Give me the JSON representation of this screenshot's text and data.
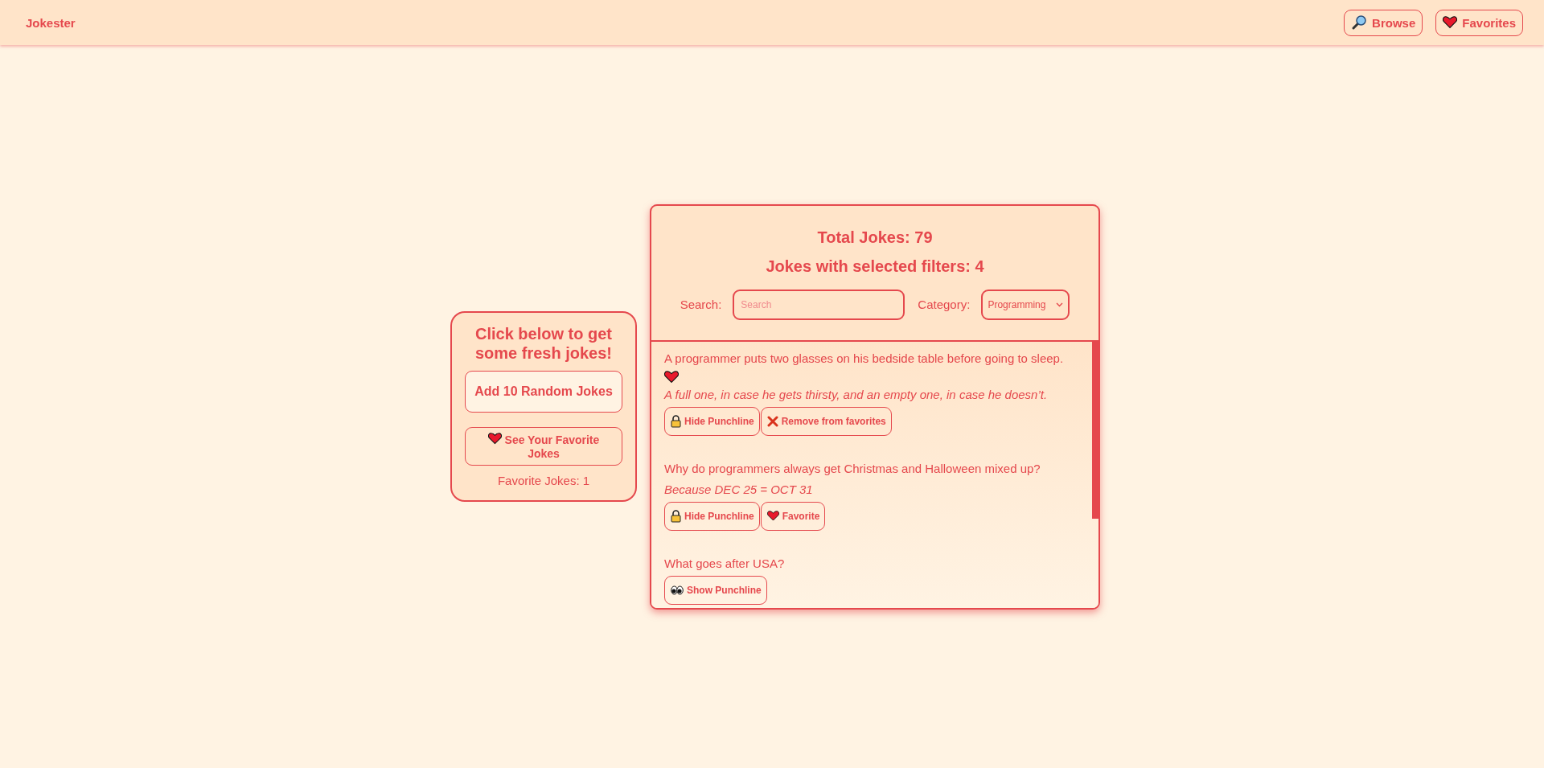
{
  "header": {
    "brand": "Jokester",
    "nav": [
      {
        "kind": "browse",
        "label": "Browse"
      },
      {
        "kind": "favorites",
        "label": "Favorites"
      }
    ]
  },
  "side_card": {
    "title": "Click below to get some fresh jokes!",
    "add_button": "Add 10 Random Jokes",
    "favorites_button": "See Your Favorite Jokes",
    "favorite_count": "Favorite Jokes: 1"
  },
  "panel": {
    "total": "Total Jokes: 79",
    "filtered": "Jokes with selected filters: 4",
    "search_label": "Search:",
    "search": {
      "placeholder": "Search"
    },
    "category_label": "Category:",
    "category": "Programming",
    "jokes": [
      {
        "setup": "A programmer puts two glasses on his bedside table before going to sleep.",
        "favorite": true,
        "punchline": "A full one, in case he gets thirsty, and an empty one, in case he doesn’t.",
        "buttons": [
          {
            "kind": "hide",
            "label": "Hide Punchline"
          },
          {
            "kind": "remove",
            "label": "Remove from favorites"
          }
        ]
      },
      {
        "setup": "Why do programmers always get Christmas and Halloween mixed up?",
        "favorite": false,
        "punchline": "Because DEC 25 = OCT 31",
        "buttons": [
          {
            "kind": "hide",
            "label": "Hide Punchline"
          },
          {
            "kind": "favorite",
            "label": "Favorite"
          }
        ]
      },
      {
        "setup": "What goes after USA?",
        "favorite": false,
        "buttons": [
          {
            "kind": "show",
            "label": "Show Punchline"
          }
        ]
      }
    ]
  }
}
